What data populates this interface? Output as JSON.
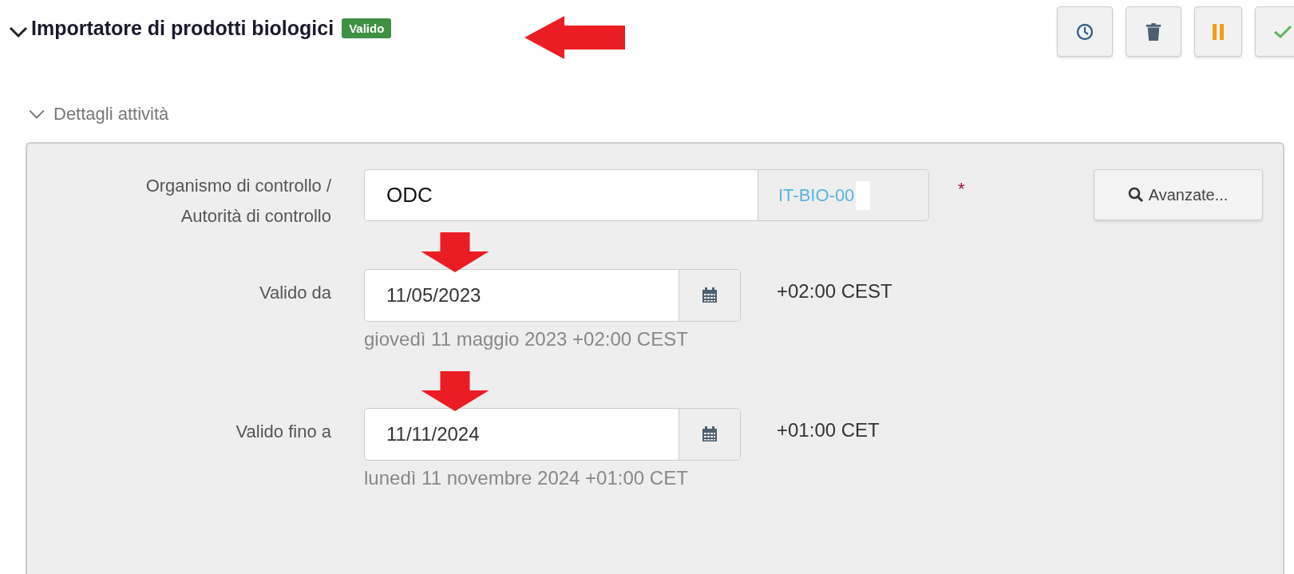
{
  "header": {
    "title": "Importatore di prodotti biologici",
    "status_badge": "Valido",
    "expanded": true
  },
  "section": {
    "title": "Dettagli attività",
    "expanded": true
  },
  "fields": [
    {
      "kind": "lookup",
      "label": "Organismo di controllo / Autorità di controllo",
      "value": "ODC",
      "code": "IT-BIO-00",
      "required_mark": "*",
      "button": "Avanzate..."
    },
    {
      "kind": "date",
      "label": "Valido da",
      "value": "11/05/2023",
      "timezone": "+02:00 CEST",
      "help": "giovedì 11 maggio 2023 +02:00 CEST"
    },
    {
      "kind": "date",
      "label": "Valido fino a",
      "value": "11/11/2024",
      "timezone": "+01:00 CET",
      "help": "lunedì 11 novembre 2024 +01:00 CET"
    }
  ]
}
